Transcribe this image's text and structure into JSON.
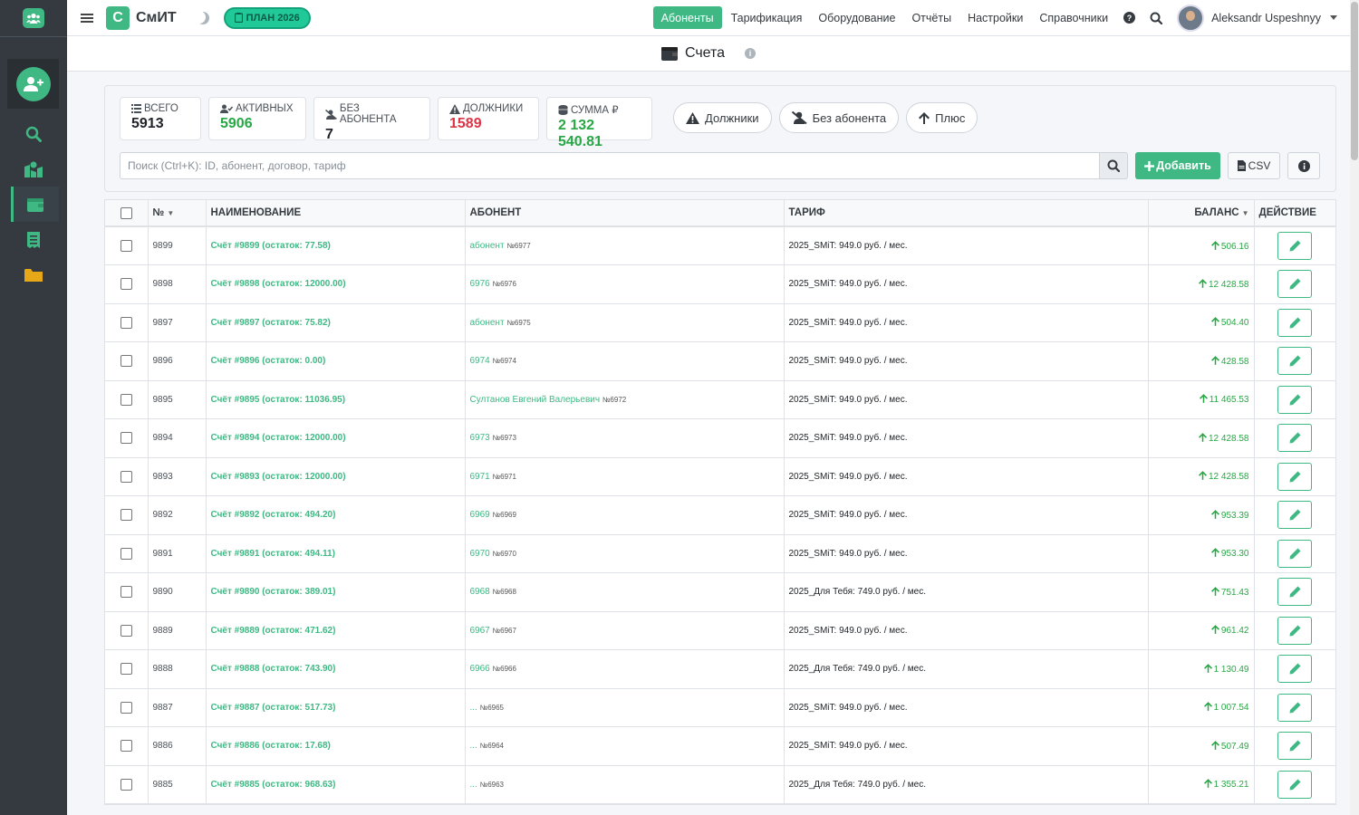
{
  "app": {
    "name": "СмИТ",
    "logo_letter": "С",
    "plan_badge": "ПЛАН 2026",
    "accent": "#3fb884"
  },
  "topnav": [
    {
      "label": "Абоненты",
      "active": true
    },
    {
      "label": "Тарификация",
      "active": false
    },
    {
      "label": "Оборудование",
      "active": false
    },
    {
      "label": "Отчёты",
      "active": false
    },
    {
      "label": "Настройки",
      "active": false
    },
    {
      "label": "Справочники",
      "active": false
    }
  ],
  "user": {
    "name": "Aleksandr Uspeshnyy"
  },
  "page": {
    "title": "Счета"
  },
  "stats": [
    {
      "label": "ВСЕГО",
      "value": "5913",
      "color": "dark",
      "icon": "list-icon"
    },
    {
      "label": "АКТИВНЫХ",
      "value": "5906",
      "color": "green",
      "icon": "user-check-icon"
    },
    {
      "label": "БЕЗ АБОНЕНТА",
      "value": "7",
      "color": "dark",
      "icon": "user-slash-icon"
    },
    {
      "label": "ДОЛЖНИКИ",
      "value": "1589",
      "color": "red",
      "icon": "warning-icon"
    },
    {
      "label": "СУММА ₽",
      "value": "2 132 540.81",
      "color": "green",
      "icon": "coins-icon"
    }
  ],
  "filters": [
    {
      "label": "Должники",
      "icon": "warning-icon"
    },
    {
      "label": "Без абонента",
      "icon": "user-slash-icon"
    },
    {
      "label": "Плюс",
      "icon": "arrow-up-icon"
    }
  ],
  "search": {
    "placeholder": "Поиск (Ctrl+K): ID, абонент, договор, тариф"
  },
  "actions": {
    "add": "Добавить",
    "csv": "CSV"
  },
  "table": {
    "headers": {
      "num": "№",
      "name": "НАИМЕНОВАНИЕ",
      "abonent": "АБОНЕНТ",
      "tariff": "ТАРИФ",
      "balance": "БАЛАНС",
      "action": "ДЕЙСТВИЕ"
    },
    "rows": [
      {
        "id": "9899",
        "name": "Счёт #9899 (остаток: 77.58)",
        "abonent": "абонент",
        "ab_num": "№6977",
        "tariff": "2025_SMiT: 949.0 руб. / мес.",
        "balance": "506.16"
      },
      {
        "id": "9898",
        "name": "Счёт #9898 (остаток: 12000.00)",
        "abonent": "6976",
        "ab_num": "№6976",
        "tariff": "2025_SMiT: 949.0 руб. / мес.",
        "balance": "12 428.58"
      },
      {
        "id": "9897",
        "name": "Счёт #9897 (остаток: 75.82)",
        "abonent": "абонент",
        "ab_num": "№6975",
        "tariff": "2025_SMiT: 949.0 руб. / мес.",
        "balance": "504.40"
      },
      {
        "id": "9896",
        "name": "Счёт #9896 (остаток: 0.00)",
        "abonent": "6974",
        "ab_num": "№6974",
        "tariff": "2025_SMiT: 949.0 руб. / мес.",
        "balance": "428.58"
      },
      {
        "id": "9895",
        "name": "Счёт #9895 (остаток: 11036.95)",
        "abonent": "Султанов Евгений Валерьевич",
        "ab_num": "№6972",
        "tariff": "2025_SMiT: 949.0 руб. / мес.",
        "balance": "11 465.53"
      },
      {
        "id": "9894",
        "name": "Счёт #9894 (остаток: 12000.00)",
        "abonent": "6973",
        "ab_num": "№6973",
        "tariff": "2025_SMiT: 949.0 руб. / мес.",
        "balance": "12 428.58"
      },
      {
        "id": "9893",
        "name": "Счёт #9893 (остаток: 12000.00)",
        "abonent": "6971",
        "ab_num": "№6971",
        "tariff": "2025_SMiT: 949.0 руб. / мес.",
        "balance": "12 428.58"
      },
      {
        "id": "9892",
        "name": "Счёт #9892 (остаток: 494.20)",
        "abonent": "6969",
        "ab_num": "№6969",
        "tariff": "2025_SMiT: 949.0 руб. / мес.",
        "balance": "953.39"
      },
      {
        "id": "9891",
        "name": "Счёт #9891 (остаток: 494.11)",
        "abonent": "6970",
        "ab_num": "№6970",
        "tariff": "2025_SMiT: 949.0 руб. / мес.",
        "balance": "953.30"
      },
      {
        "id": "9890",
        "name": "Счёт #9890 (остаток: 389.01)",
        "abonent": "6968",
        "ab_num": "№6968",
        "tariff": "2025_Для Тебя: 749.0 руб. / мес.",
        "balance": "751.43"
      },
      {
        "id": "9889",
        "name": "Счёт #9889 (остаток: 471.62)",
        "abonent": "6967",
        "ab_num": "№6967",
        "tariff": "2025_SMiT: 949.0 руб. / мес.",
        "balance": "961.42"
      },
      {
        "id": "9888",
        "name": "Счёт #9888 (остаток: 743.90)",
        "abonent": "6966",
        "ab_num": "№6966",
        "tariff": "2025_Для Тебя: 749.0 руб. / мес.",
        "balance": "1 130.49"
      },
      {
        "id": "9887",
        "name": "Счёт #9887 (остаток: 517.73)",
        "abonent": "...",
        "ab_num": "№6965",
        "tariff": "2025_SMiT: 949.0 руб. / мес.",
        "balance": "1 007.54"
      },
      {
        "id": "9886",
        "name": "Счёт #9886 (остаток: 17.68)",
        "abonent": "...",
        "ab_num": "№6964",
        "tariff": "2025_SMiT: 949.0 руб. / мес.",
        "balance": "507.49"
      },
      {
        "id": "9885",
        "name": "Счёт #9885 (остаток: 968.63)",
        "abonent": "...",
        "ab_num": "№6963",
        "tariff": "2025_Для Тебя: 749.0 руб. / мес.",
        "balance": "1 355.21"
      }
    ]
  }
}
